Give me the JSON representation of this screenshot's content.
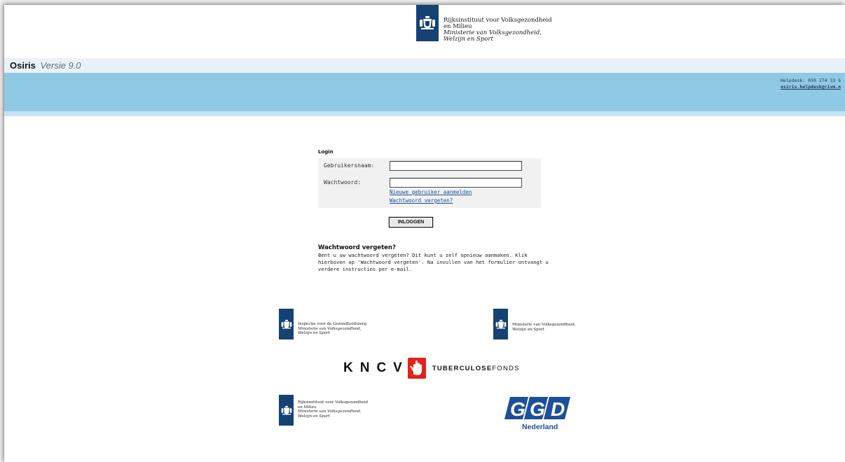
{
  "header": {
    "logo_line1": "Rijksinstituut voor Volksgezondheid",
    "logo_line2": "en Milieu",
    "logo_line3": "Ministerie van Volksgezondheid,",
    "logo_line4": "Welzijn en Sport"
  },
  "app": {
    "name": "Osiris",
    "version": "Versie 9.0"
  },
  "helpdesk": {
    "phone": "Helpdesk: 030 274 33 6",
    "email": "osiris.helpdesk@rivm.n"
  },
  "login": {
    "title": "Login",
    "username_label": "Gebruikersnaam:",
    "username_value": "",
    "password_label": "Wachtwoord:",
    "password_value": "",
    "new_user_link": "Nieuwe gebruiker aanmelden",
    "forgot_link": "Wachtwoord vergeten?",
    "submit_label": "INLOGGEN"
  },
  "help": {
    "title": "Wachtwoord vergeten?",
    "body": "Bent u uw wachtwoord vergeten? Dit kunt u zelf opnieuw aanmaken. Klik hierboven op 'Wachtwoord vergeten'. Na invullen van het formulier ontvangt u verdere instructies per e-mail."
  },
  "partners": {
    "igz": {
      "line1": "Inspectie voor de Gezondheidszorg",
      "line2": "Ministerie van Volksgezondheid,",
      "line3": "Welzijn en Sport"
    },
    "vws": {
      "line1": "Ministerie van Volksgezondheid,",
      "line2": "Welzijn en Sport"
    },
    "kncv": {
      "letters": "KNCV",
      "tb1": "TUBERCULOSE",
      "tb2": "FONDS"
    },
    "rivm": {
      "line1": "Rijksinstituut voor Volksgezondheid",
      "line2": "en Milieu",
      "line3": "Ministerie van Volksgezondheid,",
      "line4": "Welzijn en Sport"
    },
    "ggd": {
      "logo_text": "GGD",
      "sub": "Nederland"
    }
  },
  "colors": {
    "rijks_blue": "#154273",
    "banner": "#8fc9e3",
    "link": "#1a4fa0",
    "kncv_red": "#e2231a",
    "ggd_blue": "#1d4f9a"
  }
}
